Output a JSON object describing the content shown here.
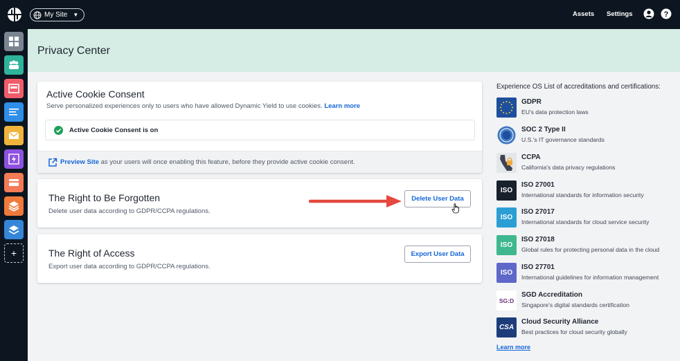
{
  "topbar": {
    "site_selector": "My Site",
    "assets": "Assets",
    "settings": "Settings"
  },
  "page": {
    "title": "Privacy Center"
  },
  "cookie_consent": {
    "title": "Active Cookie Consent",
    "description": "Serve personalized experiences only to users who have allowed Dynamic Yield to use cookies.",
    "learn_more": "Learn more",
    "status": "Active Cookie Consent is on",
    "preview_link": "Preview Site",
    "preview_text": "as your users will once enabling this feature, before they provide active cookie consent."
  },
  "forgotten": {
    "title": "The Right to Be Forgotten",
    "description": "Delete user data according to GDPR/CCPA regulations.",
    "button": "Delete User Data"
  },
  "access": {
    "title": "The Right of Access",
    "description": "Export user data according to GDPR/CCPA regulations.",
    "button": "Export User Data"
  },
  "accreditations": {
    "intro": "Experience OS List of accreditations and certifications:",
    "items": [
      {
        "name": "GDPR",
        "desc": "EU's data protection laws",
        "icon": "eu-flag-icon",
        "color": "#1d4f9c"
      },
      {
        "name": "SOC 2 Type II",
        "desc": "U.S.'s IT governance standards",
        "icon": "aicpa-soc-icon",
        "color": "#3f79c4"
      },
      {
        "name": "CCPA",
        "desc": "California's data privacy regulations",
        "icon": "california-lock-icon",
        "color": "#e4e7ea"
      },
      {
        "name": "ISO 27001",
        "desc": "International standards for information security",
        "icon": "iso-icon",
        "color": "#17202b"
      },
      {
        "name": "ISO 27017",
        "desc": "International standards for cloud service security",
        "icon": "iso-icon",
        "color": "#2b9fd4"
      },
      {
        "name": "ISO 27018",
        "desc": "Global rules for protecting personal data in the cloud",
        "icon": "iso-icon",
        "color": "#3fb890"
      },
      {
        "name": "ISO 27701",
        "desc": "International guidelines for information management",
        "icon": "iso-icon",
        "color": "#5f68c8"
      },
      {
        "name": "SGD Accreditation",
        "desc": "Singapore's digital standards certification",
        "icon": "sgd-icon",
        "color": "#ffffff"
      },
      {
        "name": "Cloud Security Alliance",
        "desc": "Best practices for cloud security globally",
        "icon": "csa-icon",
        "color": "#1d3d7a"
      }
    ],
    "iso_label": "ISO",
    "sgd_label": "SG:D",
    "csa_label": "CSA",
    "learn_more": "Learn more"
  },
  "rail": {
    "colors": [
      "#7b8592",
      "#2fb39b",
      "#f25c6a",
      "#2f8ee8",
      "#f0b43c",
      "#8e52e0",
      "#f47b56",
      "#f07a3c",
      "#3586d8"
    ]
  }
}
